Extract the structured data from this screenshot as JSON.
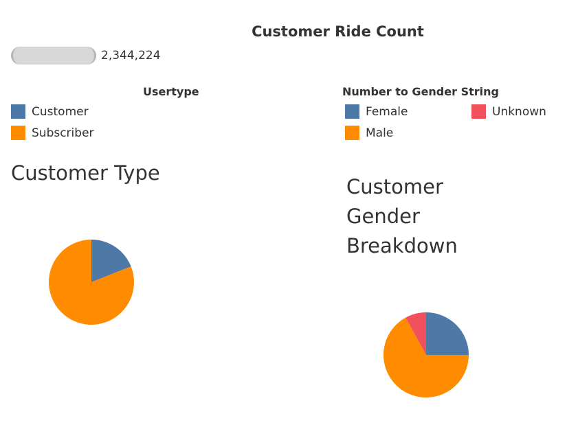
{
  "dashboard": {
    "title": "Customer Ride Count",
    "ride_count_value": "2,344,224"
  },
  "legends": {
    "usertype": {
      "title": "Usertype",
      "items": [
        {
          "label": "Customer",
          "color": "#4e79a7"
        },
        {
          "label": "Subscriber",
          "color": "#ff8c00"
        }
      ]
    },
    "gender": {
      "title": "Number to Gender String",
      "items": [
        {
          "label": "Female",
          "color": "#4e79a7"
        },
        {
          "label": "Unknown",
          "color": "#f1515d"
        },
        {
          "label": "Male",
          "color": "#ff8c00"
        }
      ]
    }
  },
  "sheets": {
    "customer_type": {
      "title": "Customer Type"
    },
    "gender_breakdown": {
      "title_lines": [
        "Customer",
        "Gender",
        "Breakdown"
      ]
    }
  },
  "chart_data": [
    {
      "type": "pie",
      "title": "Customer Type",
      "labels": [
        "Customer",
        "Subscriber"
      ],
      "values": [
        19,
        81
      ],
      "colors": [
        "#4e79a7",
        "#ff8c00"
      ]
    },
    {
      "type": "pie",
      "title": "Customer Gender Breakdown",
      "labels": [
        "Female",
        "Male",
        "Unknown"
      ],
      "values": [
        25,
        67,
        8
      ],
      "colors": [
        "#4e79a7",
        "#ff8c00",
        "#f1515d"
      ]
    }
  ]
}
